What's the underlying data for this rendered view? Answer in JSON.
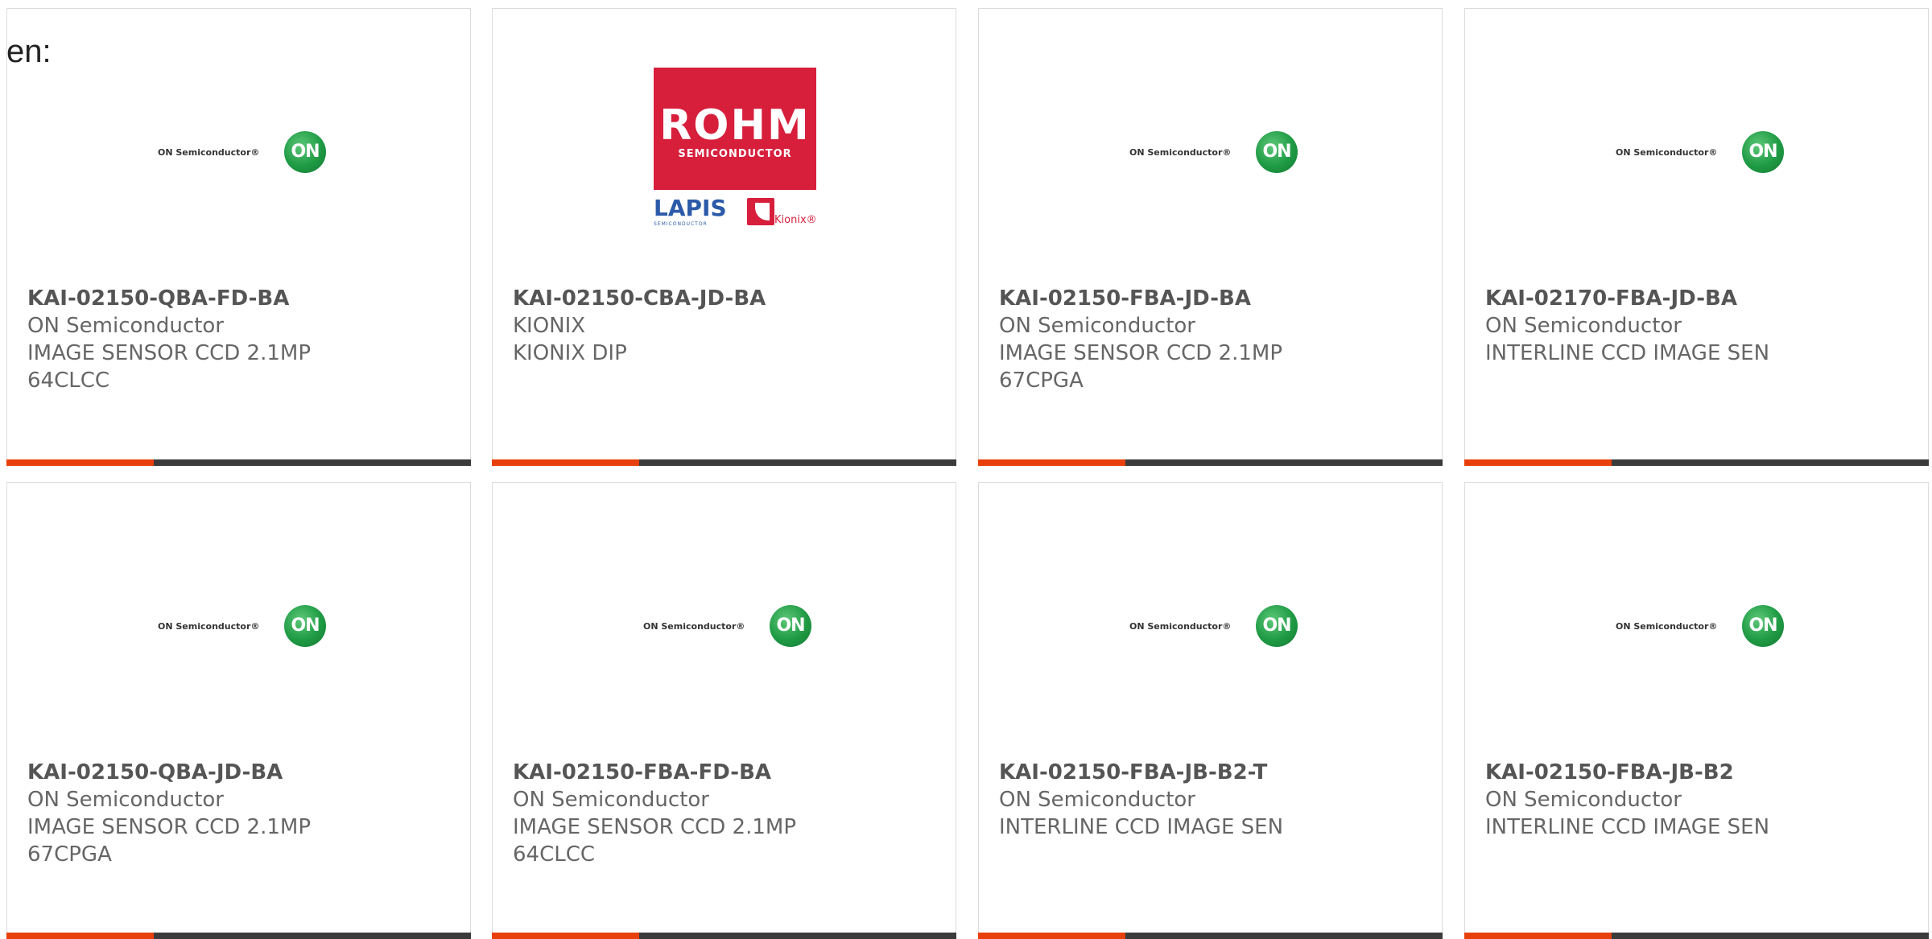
{
  "page_fragment": "en:",
  "cards": [
    {
      "part": "KAI-02150-QBA-FD-BA",
      "maker": "ON Semiconductor",
      "desc1": "IMAGE SENSOR CCD 2.1MP",
      "desc2": "64CLCC",
      "logo": "on-semiconductor-logo"
    },
    {
      "part": "KAI-02150-CBA-JD-BA",
      "maker": "KIONIX",
      "desc1": "KIONIX DIP",
      "desc2": "",
      "logo": "rohm-semiconductor-logo"
    },
    {
      "part": "KAI-02150-FBA-JD-BA",
      "maker": "ON Semiconductor",
      "desc1": "IMAGE SENSOR CCD 2.1MP",
      "desc2": "67CPGA",
      "logo": "on-semiconductor-logo"
    },
    {
      "part": "KAI-02170-FBA-JD-BA",
      "maker": "ON Semiconductor",
      "desc1": "INTERLINE CCD IMAGE SEN",
      "desc2": "",
      "logo": "on-semiconductor-logo"
    },
    {
      "part": "KAI-02150-QBA-JD-BA",
      "maker": "ON Semiconductor",
      "desc1": "IMAGE SENSOR CCD 2.1MP",
      "desc2": "67CPGA",
      "logo": "on-semiconductor-logo"
    },
    {
      "part": "KAI-02150-FBA-FD-BA",
      "maker": "ON Semiconductor",
      "desc1": "IMAGE SENSOR CCD 2.1MP",
      "desc2": "64CLCC",
      "logo": "on-semiconductor-logo"
    },
    {
      "part": "KAI-02150-FBA-JB-B2-T",
      "maker": "ON Semiconductor",
      "desc1": "INTERLINE CCD IMAGE SEN",
      "desc2": "",
      "logo": "on-semiconductor-logo"
    },
    {
      "part": "KAI-02150-FBA-JB-B2",
      "maker": "ON Semiconductor",
      "desc1": "INTERLINE CCD IMAGE SEN",
      "desc2": "",
      "logo": "on-semiconductor-logo"
    }
  ],
  "logos": {
    "on": {
      "text": "ON Semiconductor®",
      "mark": "ON"
    },
    "rohm": {
      "main": "ROHM",
      "sub": "SEMICONDUCTOR",
      "lapis": "LAPIS",
      "lapis_sub": "SEMICONDUCTOR",
      "kionix": "Kionix®"
    }
  },
  "colors": {
    "accent": "#e8400c",
    "bar": "#3b3b3b",
    "on_green": "#1f9a44",
    "rohm_red": "#d71f3c"
  }
}
